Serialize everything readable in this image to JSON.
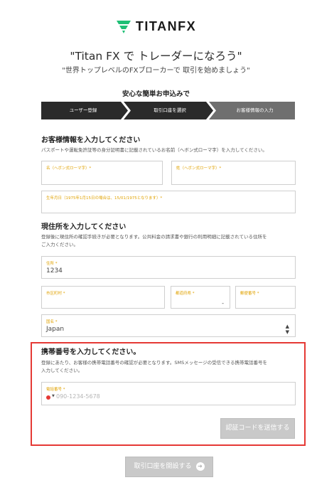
{
  "brand": {
    "name": "TITANFX",
    "accent": "#1fbf75"
  },
  "header": {
    "headline": "\"Titan FX で トレーダーになろう\"",
    "subline": "\"世界トップレベルのFXブローカーで 取引を始めましょう\""
  },
  "steps": {
    "title": "安心な簡単お申込みで",
    "items": [
      "ユーザー登録",
      "取引口座を選択",
      "お客様情報の入力"
    ],
    "active_color": "#2a2a2a",
    "inactive_color": "#6f6f6f"
  },
  "customer": {
    "title": "お客様情報を入力してください",
    "note": "パスポートや運転免許証等の身分証明書に記載されているお名前（ヘボン式ローマ字）を入力してください。",
    "first_name_label": "名（ヘボン式ローマ字）*",
    "last_name_label": "姓（ヘボン式ローマ字）*",
    "birthdate_label": "生年月日（1975年1月15日の場合は、15/01/1975となります）*"
  },
  "address": {
    "title": "現住所を入力してください",
    "note_line1": "登録後に現住所の確認手続きが必要となります。公共料金の請求書や銀行の利用明細に記載されている住所を",
    "note_line2": "ご入力ください。",
    "street_label": "住所 *",
    "street_value": "1234",
    "city_label": "市区町村 *",
    "prefecture_label": "都道府県 *",
    "prefecture_value": "-",
    "postal_label": "郵便番号 *",
    "country_label": "国名 *",
    "country_value": "Japan"
  },
  "phone": {
    "title": "携帯番号を入力してください。",
    "note_line1": "登録にあたり、お客様の携帯電話番号の確認が必要となります。SMSメッセージの受信できる携帯電話番号を",
    "note_line2": "入力してください。",
    "label": "電話番号 *",
    "placeholder": "090-1234-5678",
    "send_code_label": "認証コードを送信する",
    "highlight_color": "#e53935"
  },
  "footer": {
    "open_account_label": "取引口座を開設する",
    "arrow_icon": "arrow-right-icon"
  }
}
